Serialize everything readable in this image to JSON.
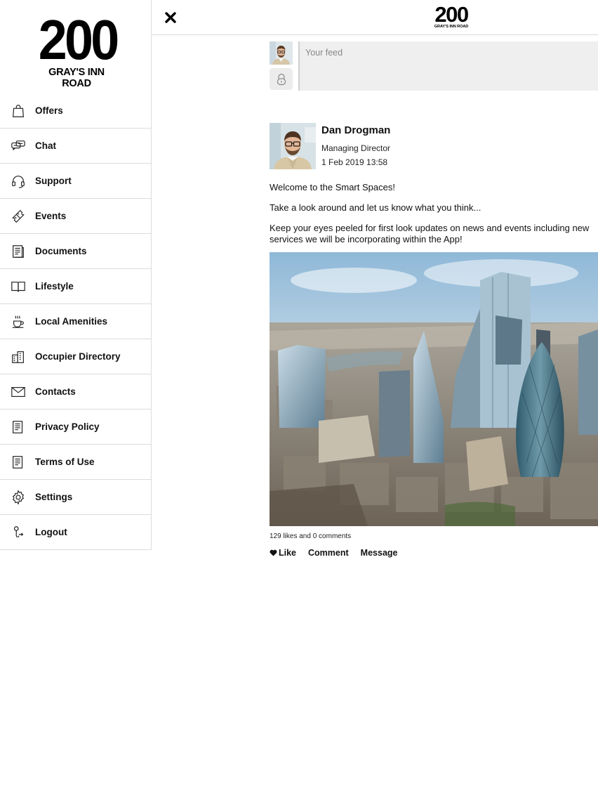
{
  "sidebar": {
    "logo": {
      "number": "200",
      "subtitle": "GRAY'S INN ROAD"
    },
    "items": [
      {
        "label": "Offers",
        "icon": "shopping-bag-icon"
      },
      {
        "label": "Chat",
        "icon": "chat-bubbles-icon"
      },
      {
        "label": "Support",
        "icon": "headset-icon"
      },
      {
        "label": "Events",
        "icon": "ticket-icon"
      },
      {
        "label": "Documents",
        "icon": "document-icon"
      },
      {
        "label": "Lifestyle",
        "icon": "open-book-icon"
      },
      {
        "label": "Local Amenities",
        "icon": "coffee-cup-icon"
      },
      {
        "label": "Occupier Directory",
        "icon": "buildings-icon"
      },
      {
        "label": "Contacts",
        "icon": "envelope-icon"
      },
      {
        "label": "Privacy Policy",
        "icon": "document-icon"
      },
      {
        "label": "Terms of Use",
        "icon": "document-icon"
      },
      {
        "label": "Settings",
        "icon": "gear-icon"
      },
      {
        "label": "Logout",
        "icon": "logout-icon"
      }
    ]
  },
  "header": {
    "close_icon": "close-icon",
    "logo": {
      "number": "200",
      "subtitle": "GRAY'S INN ROAD"
    }
  },
  "composer": {
    "placeholder": "Your feed",
    "privacy_icon": "lock-icon"
  },
  "post": {
    "author": "Dan Drogman",
    "role": "Managing Director",
    "date": "1 Feb 2019 13:58",
    "paragraphs": [
      "Welcome to the Smart Spaces!",
      "Take a look around and let us know what you think...",
      "Keep your eyes peeled for first look updates on news and events including new services we will be incorporating within the App!"
    ],
    "image_subject": "London city skyline aerial view",
    "stats": "129 likes and 0 comments",
    "actions": {
      "like": "Like",
      "comment": "Comment",
      "message": "Message"
    }
  },
  "colors": {
    "divider": "#dcdcdc",
    "input_bg": "#efefef",
    "text": "#111111"
  }
}
